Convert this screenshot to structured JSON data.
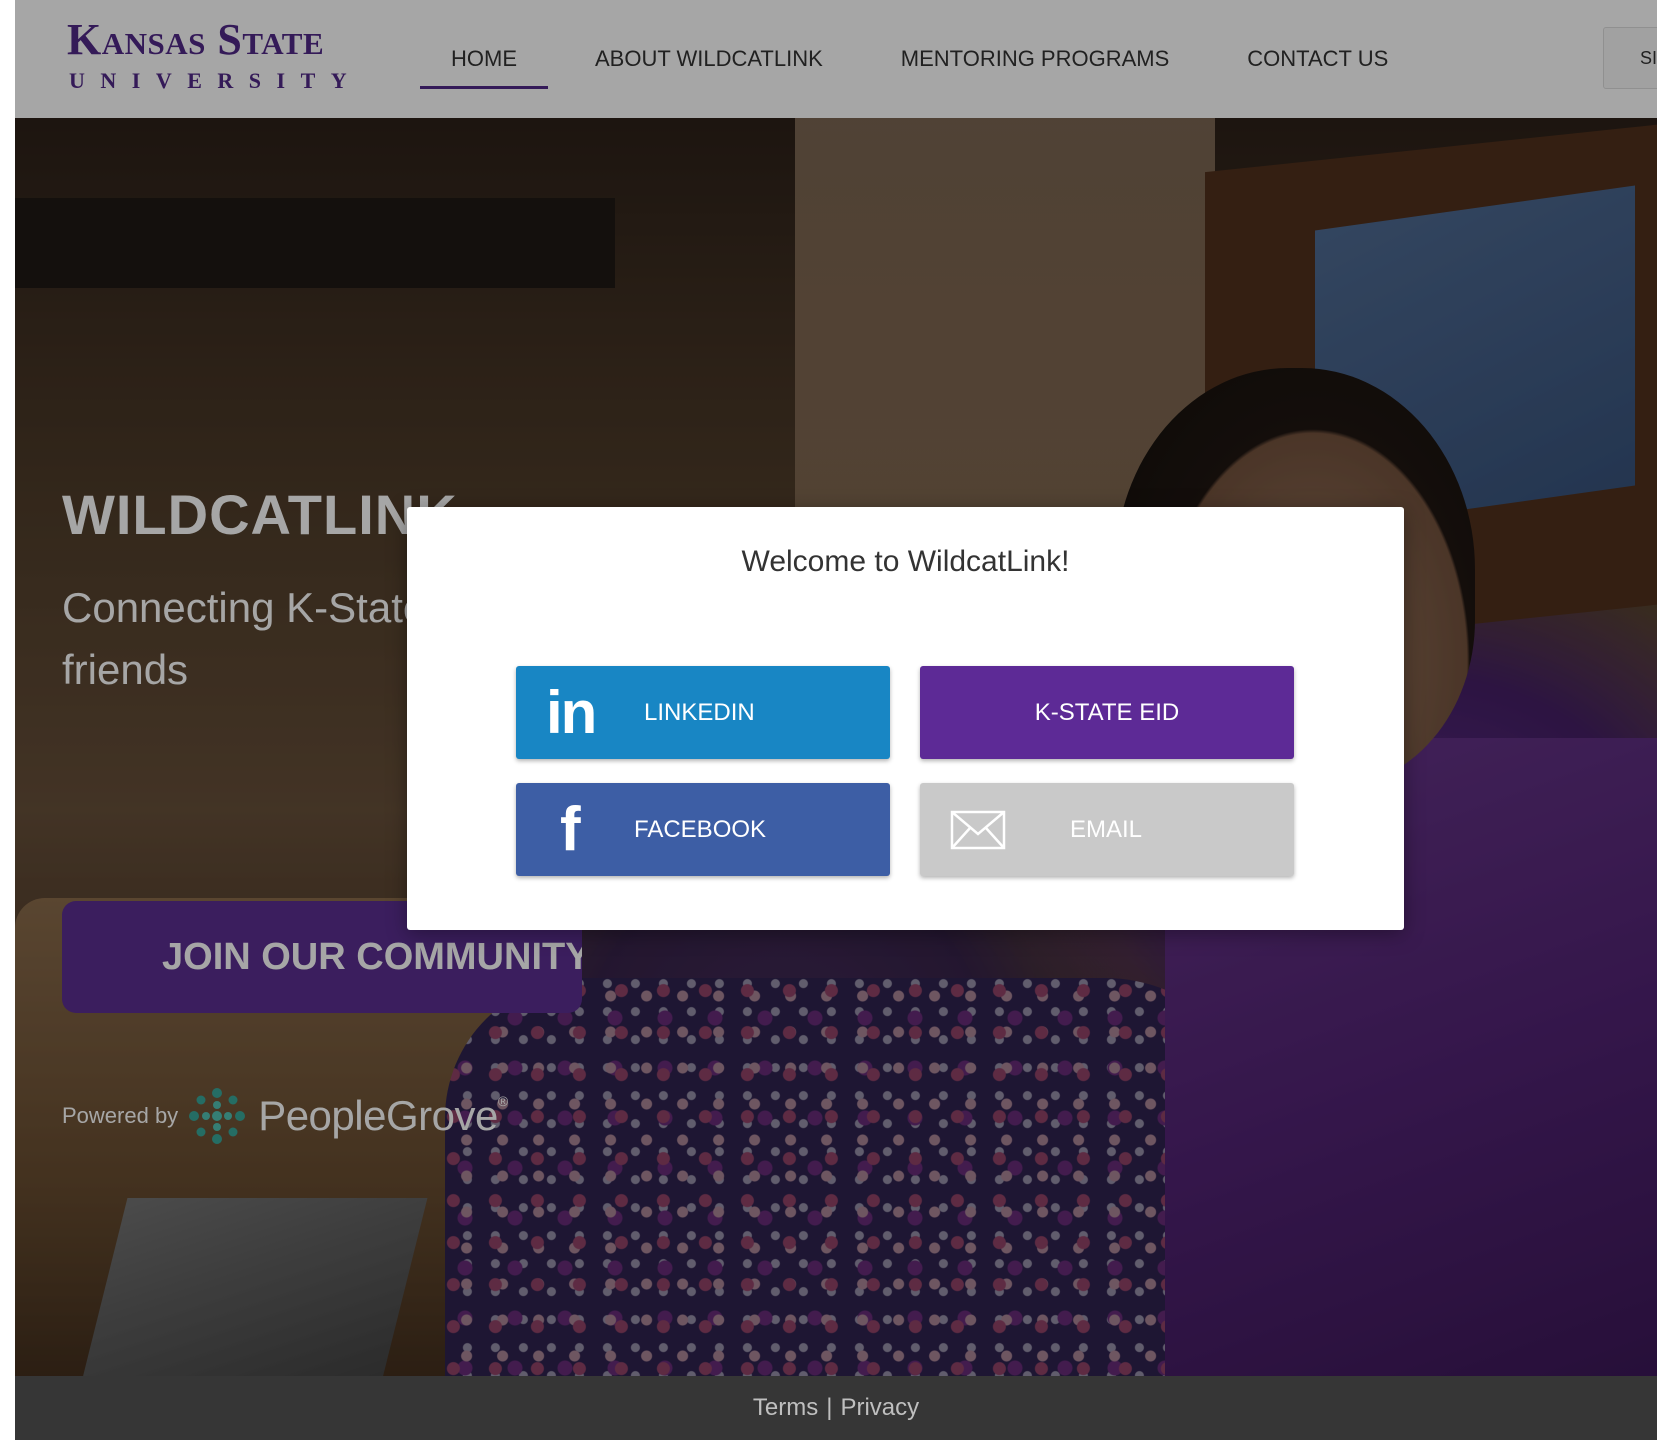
{
  "header": {
    "logo": {
      "line1": "Kansas State",
      "line2": "UNIVERSITY"
    },
    "nav": [
      {
        "label": "HOME",
        "active": true
      },
      {
        "label": "ABOUT WILDCATLINK",
        "active": false
      },
      {
        "label": "MENTORING PROGRAMS",
        "active": false
      },
      {
        "label": "CONTACT US",
        "active": false
      }
    ],
    "signin_label": "SI"
  },
  "hero": {
    "title": "WILDCATLINK",
    "subtitle": "Connecting K-State alumni and friends",
    "join_label": "JOIN OUR COMMUNITY",
    "powered_by": "Powered by",
    "brand": "PeopleGrove",
    "brand_mark": "®"
  },
  "modal": {
    "title": "Welcome to WildcatLink!",
    "buttons": {
      "linkedin": {
        "label": "LINKEDIN",
        "icon": "linkedin-icon",
        "icon_text": "in",
        "color": "#1886c4"
      },
      "keid": {
        "label": "K-STATE EID",
        "color": "#5d2a96"
      },
      "facebook": {
        "label": "FACEBOOK",
        "icon": "facebook-icon",
        "icon_text": "f",
        "color": "#3d5ea5"
      },
      "email": {
        "label": "EMAIL",
        "icon": "envelope-icon",
        "color": "#c9c9c9"
      }
    }
  },
  "footer": {
    "terms": "Terms",
    "separator": "|",
    "privacy": "Privacy"
  },
  "colors": {
    "brand_purple": "#512888",
    "footer_bg": "#363636"
  }
}
